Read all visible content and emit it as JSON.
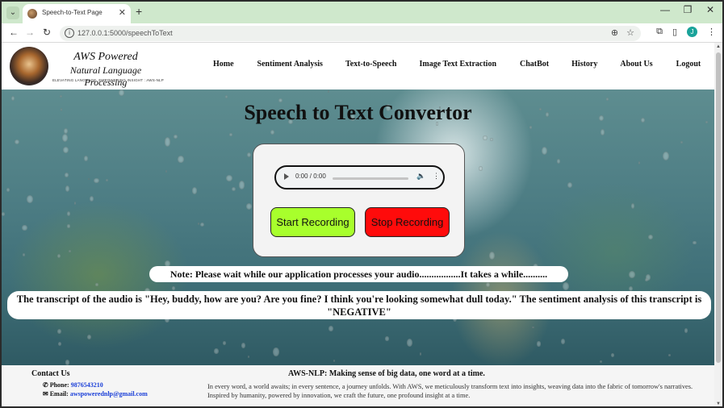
{
  "browser": {
    "tab_title": "Speech-to-Text Page",
    "url": "127.0.0.1:5000/speechToText",
    "avatar_letter": "J"
  },
  "brand": {
    "title": "AWS Powered",
    "subtitle": "Natural Language Processing",
    "tagline": "ELEVATING LANGUAGE, EMPOWERING INSIGHT : AWS-NLP"
  },
  "nav": {
    "items": [
      {
        "label": "Home"
      },
      {
        "label": "Sentiment Analysis"
      },
      {
        "label": "Text-to-Speech"
      },
      {
        "label": "Image Text Extraction"
      },
      {
        "label": "ChatBot"
      },
      {
        "label": "History"
      },
      {
        "label": "About Us"
      },
      {
        "label": "Logout"
      }
    ]
  },
  "main": {
    "title": "Speech to Text Convertor",
    "audio_time": "0:00 / 0:00",
    "start_button": "Start Recording",
    "stop_button": "Stop Recording",
    "note": "Note: Please wait while our application processes your audio.................It takes a while..........",
    "transcript": "The transcript of the audio is \"Hey, buddy, how are you? Are you fine? I think you're looking somewhat dull today.\" The sentiment analysis of this transcript is \"NEGATIVE\""
  },
  "footer": {
    "contact_title": "Contact Us",
    "phone_label": "Phone:",
    "phone": "9876543210",
    "email_label": "Email:",
    "email": "awspowerednlp@gmail.com",
    "heading": "AWS-NLP: Making sense of big data, one word at a time.",
    "text": "In every word, a world awaits; in every sentence, a journey unfolds. With AWS, we meticulously transform text into insights, weaving data into the fabric of tomorrow's narratives. Inspired by humanity, powered by innovation, we craft the future, one profound insight at a time."
  },
  "colors": {
    "start_button": "#a8ff2c",
    "stop_button": "#ff0b0b",
    "link": "#1a3fd8",
    "tab_strip": "#cfe8cc"
  }
}
